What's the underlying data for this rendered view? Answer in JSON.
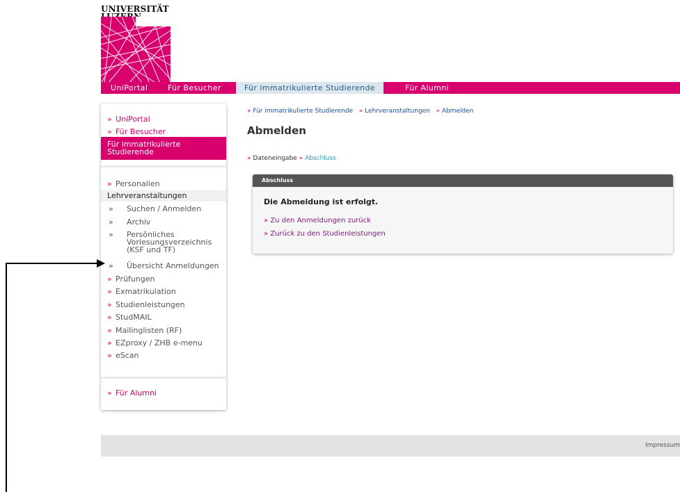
{
  "logo": {
    "line1": "UNIVERSITÄT",
    "line2": "LUZERN"
  },
  "topnav": [
    {
      "label": "UniPortal",
      "active": false
    },
    {
      "label": "Für Besucher",
      "active": false
    },
    {
      "label": "Für immatrikulierte Studierende",
      "active": true
    },
    {
      "label": "Für Alumni",
      "active": false
    }
  ],
  "sidebar": {
    "mark": "»",
    "top": [
      {
        "label": "UniPortal"
      },
      {
        "label": "Für Besucher"
      }
    ],
    "active_line1": "Für immatrikulierte",
    "active_line2": "Studierende",
    "personalien": "Personalien",
    "current": "Lehrveranstaltungen",
    "sub": [
      {
        "label": "Suchen / Anmelden"
      },
      {
        "label": "Archiv"
      },
      {
        "label_l1": "Persönliches",
        "label_l2": "Vorlesungsverzeichnis",
        "label_l3": "(KSF und TF)"
      },
      {
        "label": "Übersicht Anmeldungen"
      }
    ],
    "more": [
      {
        "label": "Prüfungen"
      },
      {
        "label": "Exmatrikulation"
      },
      {
        "label": "Studienleistungen"
      },
      {
        "label": "StudMAIL"
      },
      {
        "label": "Mailinglisten (RF)"
      },
      {
        "label": "EZproxy / ZHB e-menu"
      },
      {
        "label": "eScan"
      }
    ],
    "alumni": "Für Alumni"
  },
  "breadcrumb": [
    {
      "label": "Für immatrikulierte Studierende"
    },
    {
      "label": "Lehrveranstaltungen"
    },
    {
      "label": "Abmelden"
    }
  ],
  "page_title": "Abmelden",
  "steps": {
    "step1": "Dateneingabe",
    "step2": "Abschluss"
  },
  "panel": {
    "header": "Abschluss",
    "message": "Die Abmeldung ist erfolgt.",
    "link1": "Zu den Anmeldungen zurück",
    "link2": "Zurück zu den Studienleistungen"
  },
  "footer": {
    "impressum": "Impressum"
  },
  "colors": {
    "brand": "#d7006d",
    "nav_active_bg": "#dbe6ef",
    "panel_header": "#555555"
  }
}
